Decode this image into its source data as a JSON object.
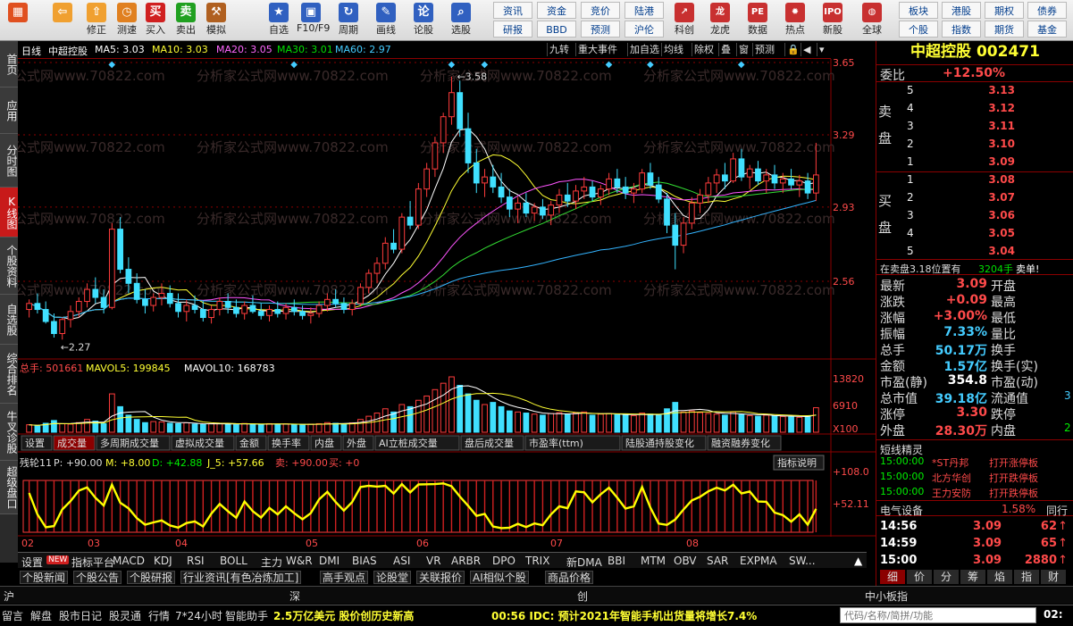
{
  "toolbar": {
    "buttons": [
      {
        "label": "",
        "icon": "grid-icon",
        "color": "#e05020"
      },
      {
        "label": "",
        "icon": "back-arrow-icon",
        "color": "#f0a030"
      },
      {
        "label": "修正",
        "icon": "up-arrow-icon",
        "color": "#f0a030"
      },
      {
        "label": "测速",
        "icon": "clock-icon",
        "color": "#e08020"
      },
      {
        "label": "买入",
        "icon": "buy-icon",
        "color": "#d02020"
      },
      {
        "label": "卖出",
        "icon": "sell-icon",
        "color": "#20a020"
      },
      {
        "label": "模拟",
        "icon": "hammer-icon",
        "color": "#b06020"
      },
      {
        "label": "自选",
        "icon": "star-icon",
        "color": "#3060c0"
      },
      {
        "label": "F10/F9",
        "icon": "window-icon",
        "color": "#3060c0"
      },
      {
        "label": "周期",
        "icon": "cycle-icon",
        "color": "#3060c0"
      },
      {
        "label": "画线",
        "icon": "pen-icon",
        "color": "#3060c0"
      },
      {
        "label": "论股",
        "icon": "comment-icon",
        "color": "#3060c0"
      },
      {
        "label": "选股",
        "icon": "magnifier-icon",
        "color": "#3060c0"
      }
    ],
    "grid_buttons": [
      [
        "资讯",
        "研报"
      ],
      [
        "资金",
        "BBD"
      ],
      [
        "竞价",
        "预测"
      ],
      [
        "陆港",
        "沪伦"
      ]
    ],
    "more_buttons": [
      {
        "label": "科创",
        "icon": "chart-icon"
      },
      {
        "label": "龙虎",
        "icon": "dragon-icon"
      },
      {
        "label": "数据",
        "icon": "pe-icon"
      },
      {
        "label": "热点",
        "icon": "hot-icon"
      },
      {
        "label": "新股",
        "icon": "ipo-icon"
      },
      {
        "label": "全球",
        "icon": "globe-icon"
      }
    ],
    "right_grid": [
      [
        "板块",
        "港股",
        "期权",
        "债券"
      ],
      [
        "个股",
        "指数",
        "期货",
        "基金"
      ]
    ]
  },
  "left_nav": [
    "首页",
    "应用",
    "分时图",
    "K线图",
    "个股资料",
    "自选股",
    "综合排名",
    "牛叉诊股",
    "超级盘口"
  ],
  "left_nav_active": 3,
  "chart_header": {
    "period": "日线",
    "name": "中超控股",
    "ma5": "MA5: 3.03",
    "ma10": "MA10: 3.03",
    "ma20": "MA20: 3.05",
    "ma30": "MA30: 3.01",
    "ma60": "MA60: 2.97",
    "buttons": [
      "九转",
      "重大事件",
      "加自选",
      "均线",
      "除权",
      "叠",
      "窗",
      "预测"
    ]
  },
  "colors": {
    "up": "#ff3c3c",
    "down": "#40e0ff",
    "ma5": "#ffffff",
    "ma10": "#ffff33",
    "ma20": "#ff55ff",
    "ma30": "#33dd33",
    "ma60": "#33b4ff",
    "grid": "#8b0000",
    "osc": "#ffff00"
  },
  "watermark": "分析家公式网www.70822.com",
  "price_axis": {
    "labels": [
      "3.65",
      "3.29",
      "2.93",
      "2.56"
    ],
    "ymax": 3.65,
    "ymin": 2.2
  },
  "price_annotations": {
    "high": "3.58",
    "low": "2.27"
  },
  "volume_header": {
    "total": "总手: 501661",
    "mavol5": "MAVOL5: 199845",
    "mavol10": "MAVOL10: 168783"
  },
  "volume_axis": {
    "labels": [
      "13820",
      "6910",
      "X100"
    ]
  },
  "volume_tabs": [
    "设置",
    "成交量",
    "多周期成交量",
    "虚拟成交量",
    "金额",
    "换手率",
    "内盘",
    "外盘",
    "AI立桩成交量",
    "盘后成交量",
    "市盈率(ttm)",
    "陆股通持股变化",
    "融资融券变化"
  ],
  "volume_tab_active": 1,
  "osc_header": {
    "name": "残轮11",
    "p": "P: +90.00",
    "m": "M: +8.00",
    "d": "D: +42.88",
    "j": "J_5: +57.66",
    "sell": "卖: +90.00",
    "buy": "买: +0",
    "explain": "指标说明"
  },
  "osc_axis": {
    "labels": [
      "+108.0",
      "+52.11"
    ]
  },
  "time_axis": [
    "02",
    "03",
    "04",
    "05",
    "06",
    "07",
    "08"
  ],
  "indicator_tabs": [
    "设置",
    "指标平台",
    "MACD",
    "KDJ",
    "RSI",
    "BOLL",
    "主力",
    "W&R",
    "DMI",
    "BIAS",
    "ASI",
    "VR",
    "ARBR",
    "DPO",
    "TRIX",
    "新DMA",
    "BBI",
    "MTM",
    "OBV",
    "SAR",
    "EXPMA",
    "SW..."
  ],
  "indicator_new_badge": "NEW",
  "news_tabs": [
    "个股新闻",
    "个股公告",
    "个股研报",
    "行业资讯[有色冶炼加工]",
    "高手观点",
    "论股堂",
    "关联报价",
    "AI相似个股",
    "商品价格"
  ],
  "right": {
    "title": "中超控股 002471",
    "weibi_label": "委比",
    "weibi": "+12.50%",
    "sell_label": "卖盘",
    "buy_label": "买盘",
    "sell": [
      {
        "lvl": "5",
        "px": "3.13"
      },
      {
        "lvl": "4",
        "px": "3.12"
      },
      {
        "lvl": "3",
        "px": "3.11"
      },
      {
        "lvl": "2",
        "px": "3.10"
      },
      {
        "lvl": "1",
        "px": "3.09"
      }
    ],
    "buy": [
      {
        "lvl": "1",
        "px": "3.08"
      },
      {
        "lvl": "2",
        "px": "3.07"
      },
      {
        "lvl": "3",
        "px": "3.06"
      },
      {
        "lvl": "4",
        "px": "3.05"
      },
      {
        "lvl": "5",
        "px": "3.04"
      }
    ],
    "alert": {
      "text": "在卖盘3.18位置有",
      "qty": "3204手",
      "action": "卖单!"
    },
    "stats": [
      {
        "l": "最新",
        "v": "3.09",
        "c": "red",
        "l2": "开盘"
      },
      {
        "l": "涨跌",
        "v": "+0.09",
        "c": "red",
        "l2": "最高"
      },
      {
        "l": "涨幅",
        "v": "+3.00%",
        "c": "red",
        "l2": "最低"
      },
      {
        "l": "振幅",
        "v": "7.33%",
        "c": "cyn",
        "l2": "量比"
      },
      {
        "l": "总手",
        "v": "50.17万",
        "c": "cyn",
        "l2": "换手"
      },
      {
        "l": "金额",
        "v": "1.57亿",
        "c": "cyn",
        "l2": "换手(实)"
      },
      {
        "l": "市盈(静)",
        "v": "354.8",
        "c": "wht",
        "l2": "市盈(动)"
      },
      {
        "l": "总市值",
        "v": "39.18亿",
        "c": "cyn",
        "l2": "流通值"
      },
      {
        "l": "涨停",
        "v": "3.30",
        "c": "red",
        "l2": "跌停"
      },
      {
        "l": "外盘",
        "v": "28.30万",
        "c": "red",
        "l2": "内盘"
      }
    ],
    "stats_edge": [
      "",
      "",
      "",
      "",
      "",
      "",
      "",
      "3",
      "",
      "2"
    ],
    "brief_title": "短线精灵",
    "brief": [
      {
        "t": "15:00:00",
        "n": "*ST丹邦",
        "e": "打开涨停板"
      },
      {
        "t": "15:00:00",
        "n": "北方华创",
        "e": "打开跌停板"
      },
      {
        "t": "15:00:00",
        "n": "王力安防",
        "e": "打开跌停板"
      }
    ],
    "industry": {
      "name": "电气设备",
      "chg": "1.58%",
      "btn": "同行"
    },
    "ticks": [
      {
        "t": "14:56",
        "p": "3.09",
        "q": "62",
        "d": "↑"
      },
      {
        "t": "14:59",
        "p": "3.09",
        "q": "65",
        "d": "↑"
      },
      {
        "t": "15:00",
        "p": "3.09",
        "q": "2880",
        "d": "↑"
      }
    ],
    "bottom_tabs": [
      "细",
      "价",
      "分",
      "筹",
      "焰",
      "指",
      "财"
    ]
  },
  "market_bar": {
    "sh": "沪",
    "sz": "深",
    "cy": "创",
    "zxb": "中小板指"
  },
  "status": {
    "items": [
      "留言",
      "解盘",
      "股市日记",
      "股灵通",
      "行情",
      "7*24小时",
      "智能助手"
    ],
    "ticker1": "2.5万亿美元  股价创历史新高",
    "ticker2": "00:56 IDC: 预计2021年智能手机出货量将增长7.4%",
    "search_placeholder": "代码/名称/简拼/功能",
    "clock": "02:"
  },
  "chart_data": {
    "type": "candlestick",
    "x_ticks": [
      "02",
      "03",
      "04",
      "05",
      "06",
      "07",
      "08"
    ],
    "ylim": [
      2.2,
      3.65
    ],
    "ohlc": [
      [
        2.42,
        2.47,
        2.38,
        2.45
      ],
      [
        2.45,
        2.5,
        2.4,
        2.42
      ],
      [
        2.42,
        2.46,
        2.35,
        2.36
      ],
      [
        2.36,
        2.4,
        2.28,
        2.3
      ],
      [
        2.3,
        2.38,
        2.27,
        2.37
      ],
      [
        2.37,
        2.44,
        2.33,
        2.41
      ],
      [
        2.41,
        2.48,
        2.38,
        2.46
      ],
      [
        2.46,
        2.55,
        2.43,
        2.52
      ],
      [
        2.52,
        2.58,
        2.45,
        2.48
      ],
      [
        2.48,
        2.52,
        2.4,
        2.43
      ],
      [
        2.43,
        2.85,
        2.42,
        2.82
      ],
      [
        2.82,
        2.88,
        2.6,
        2.62
      ],
      [
        2.62,
        2.68,
        2.5,
        2.55
      ],
      [
        2.55,
        2.6,
        2.45,
        2.47
      ],
      [
        2.47,
        2.52,
        2.4,
        2.44
      ],
      [
        2.44,
        2.5,
        2.41,
        2.48
      ],
      [
        2.48,
        2.55,
        2.44,
        2.5
      ],
      [
        2.5,
        2.54,
        2.43,
        2.45
      ],
      [
        2.45,
        2.5,
        2.38,
        2.41
      ],
      [
        2.41,
        2.47,
        2.36,
        2.44
      ],
      [
        2.44,
        2.49,
        2.4,
        2.42
      ],
      [
        2.42,
        2.46,
        2.36,
        2.38
      ],
      [
        2.38,
        2.44,
        2.35,
        2.42
      ],
      [
        2.42,
        2.48,
        2.39,
        2.46
      ],
      [
        2.46,
        2.5,
        2.4,
        2.43
      ],
      [
        2.43,
        2.47,
        2.38,
        2.4
      ],
      [
        2.4,
        2.46,
        2.37,
        2.44
      ],
      [
        2.44,
        2.49,
        2.4,
        2.41
      ],
      [
        2.41,
        2.45,
        2.37,
        2.39
      ],
      [
        2.39,
        2.44,
        2.36,
        2.42
      ],
      [
        2.42,
        2.46,
        2.38,
        2.4
      ],
      [
        2.4,
        2.45,
        2.37,
        2.43
      ],
      [
        2.43,
        2.47,
        2.39,
        2.41
      ],
      [
        2.41,
        2.44,
        2.37,
        2.39
      ],
      [
        2.39,
        2.43,
        2.35,
        2.4
      ],
      [
        2.4,
        2.46,
        2.38,
        2.44
      ],
      [
        2.44,
        2.5,
        2.41,
        2.47
      ],
      [
        2.47,
        2.52,
        2.43,
        2.45
      ],
      [
        2.45,
        2.48,
        2.4,
        2.42
      ],
      [
        2.42,
        2.47,
        2.39,
        2.45
      ],
      [
        2.45,
        2.55,
        2.44,
        2.53
      ],
      [
        2.53,
        2.62,
        2.5,
        2.6
      ],
      [
        2.6,
        2.68,
        2.55,
        2.65
      ],
      [
        2.65,
        2.78,
        2.62,
        2.75
      ],
      [
        2.75,
        2.82,
        2.7,
        2.72
      ],
      [
        2.72,
        2.9,
        2.7,
        2.88
      ],
      [
        2.88,
        2.96,
        2.82,
        2.84
      ],
      [
        2.84,
        3.05,
        2.82,
        3.02
      ],
      [
        3.02,
        3.15,
        2.98,
        3.12
      ],
      [
        3.12,
        3.28,
        3.08,
        3.25
      ],
      [
        3.25,
        3.4,
        3.2,
        3.38
      ],
      [
        3.38,
        3.58,
        3.34,
        3.5
      ],
      [
        3.5,
        3.56,
        3.28,
        3.32
      ],
      [
        3.32,
        3.4,
        3.1,
        3.15
      ],
      [
        3.15,
        3.22,
        3.0,
        3.05
      ],
      [
        3.05,
        3.12,
        2.98,
        3.08
      ],
      [
        3.08,
        3.14,
        3.0,
        3.03
      ],
      [
        3.03,
        3.1,
        2.95,
        2.98
      ],
      [
        2.98,
        3.02,
        2.88,
        2.92
      ],
      [
        2.92,
        2.98,
        2.85,
        2.95
      ],
      [
        2.95,
        3.0,
        2.88,
        2.9
      ],
      [
        2.9,
        2.95,
        2.86,
        2.93
      ],
      [
        2.93,
        2.97,
        2.87,
        2.89
      ],
      [
        2.89,
        2.96,
        2.84,
        2.94
      ],
      [
        2.94,
        3.02,
        2.9,
        2.99
      ],
      [
        2.99,
        3.05,
        2.93,
        2.96
      ],
      [
        2.96,
        3.04,
        2.92,
        3.01
      ],
      [
        3.01,
        3.08,
        2.97,
        3.03
      ],
      [
        3.03,
        3.06,
        2.96,
        2.98
      ],
      [
        2.98,
        3.04,
        2.94,
        3.02
      ],
      [
        3.02,
        3.1,
        2.99,
        3.07
      ],
      [
        3.07,
        3.12,
        3.0,
        3.03
      ],
      [
        3.03,
        3.08,
        2.97,
        3.0
      ],
      [
        3.0,
        3.05,
        2.95,
        3.02
      ],
      [
        3.02,
        3.12,
        3.0,
        3.1
      ],
      [
        3.1,
        3.15,
        3.02,
        3.04
      ],
      [
        3.04,
        3.08,
        2.95,
        2.97
      ],
      [
        2.97,
        3.0,
        2.8,
        2.84
      ],
      [
        2.84,
        2.9,
        2.62,
        2.74
      ],
      [
        2.74,
        2.88,
        2.7,
        2.85
      ],
      [
        2.85,
        2.98,
        2.82,
        2.95
      ],
      [
        2.95,
        3.02,
        2.9,
        2.99
      ],
      [
        2.99,
        3.08,
        2.95,
        3.05
      ],
      [
        3.05,
        3.12,
        3.0,
        3.09
      ],
      [
        3.09,
        3.15,
        3.02,
        3.06
      ],
      [
        3.06,
        3.2,
        3.05,
        3.17
      ],
      [
        3.17,
        3.22,
        3.06,
        3.08
      ],
      [
        3.08,
        3.14,
        3.02,
        3.12
      ],
      [
        3.12,
        3.16,
        3.04,
        3.06
      ],
      [
        3.06,
        3.12,
        3.0,
        3.09
      ],
      [
        3.09,
        3.14,
        3.02,
        3.05
      ],
      [
        3.05,
        3.1,
        3.0,
        3.07
      ],
      [
        3.07,
        3.12,
        3.02,
        3.04
      ],
      [
        3.04,
        3.09,
        2.98,
        3.06
      ],
      [
        3.06,
        3.1,
        2.97,
        3.0
      ],
      [
        3.0,
        3.25,
        2.96,
        3.09
      ]
    ],
    "volume": [
      35,
      30,
      42,
      55,
      40,
      38,
      45,
      60,
      52,
      40,
      180,
      120,
      80,
      60,
      45,
      50,
      48,
      42,
      40,
      44,
      38,
      36,
      40,
      42,
      39,
      35,
      41,
      38,
      36,
      40,
      37,
      39,
      36,
      34,
      38,
      40,
      45,
      42,
      40,
      44,
      60,
      75,
      90,
      110,
      95,
      130,
      120,
      150,
      170,
      200,
      230,
      260,
      220,
      180,
      150,
      130,
      140,
      120,
      100,
      95,
      90,
      85,
      80,
      88,
      92,
      85,
      90,
      95,
      80,
      85,
      88,
      82,
      80,
      78,
      90,
      85,
      80,
      110,
      140,
      95,
      100,
      92,
      88,
      85,
      80,
      95,
      82,
      78,
      75,
      80,
      76,
      74,
      72,
      70,
      75,
      115
    ]
  }
}
